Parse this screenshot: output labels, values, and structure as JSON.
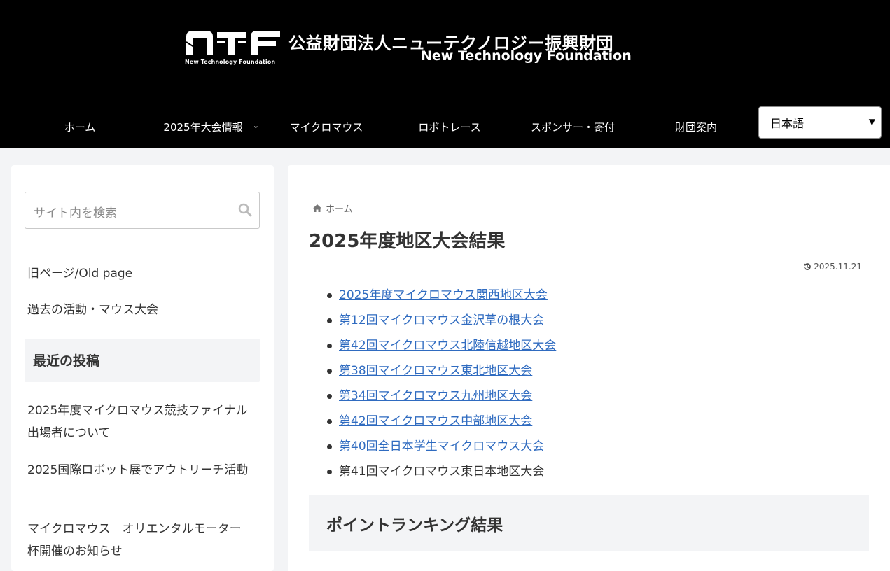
{
  "header": {
    "logo_jp": "公益財団法人ニューテクノロジー振興財団",
    "logo_en": "New Technology Foundation",
    "logo_mark_sub": "New Technology Foundation",
    "nav": [
      {
        "label": "ホーム"
      },
      {
        "label": "2025年大会情報"
      },
      {
        "label": "マイクロマウス"
      },
      {
        "label": "ロボトレース"
      },
      {
        "label": "スポンサー・寄付"
      },
      {
        "label": "財団案内"
      }
    ],
    "language": {
      "selected": "日本語"
    }
  },
  "sidebar": {
    "search_placeholder": "サイト内を検索",
    "links": [
      "旧ページ/Old page",
      "過去の活動・マウス大会"
    ],
    "recent_heading": "最近の投稿",
    "recent_posts": [
      "2025年度マイクロマウス競技ファイナル出場者について",
      "2025国際ロボット展でアウトリーチ活動",
      "マイクロマウス　オリエンタルモーター杯開催のお知らせ"
    ]
  },
  "main": {
    "breadcrumb": "ホーム",
    "title": "2025年度地区大会結果",
    "date": "2025.11.21",
    "results": [
      "2025年度マイクロマウス関西地区大会",
      "第12回マイクロマウス金沢草の根大会",
      "第42回マイクロマウス北陸信越地区大会",
      "第38回マイクロマウス東北地区大会",
      "第34回マイクロマウス九州地区大会",
      "第42回マイクロマウス中部地区大会",
      "第40回全日本学生マイクロマウス大会"
    ],
    "result_plain": "第41回マイクロマウス東日本地区大会",
    "ranking_heading": "ポイントランキング結果"
  },
  "colors": {
    "header_bg": "#000000",
    "link": "#2f6bc0",
    "page_bg": "#f3f4f6"
  }
}
